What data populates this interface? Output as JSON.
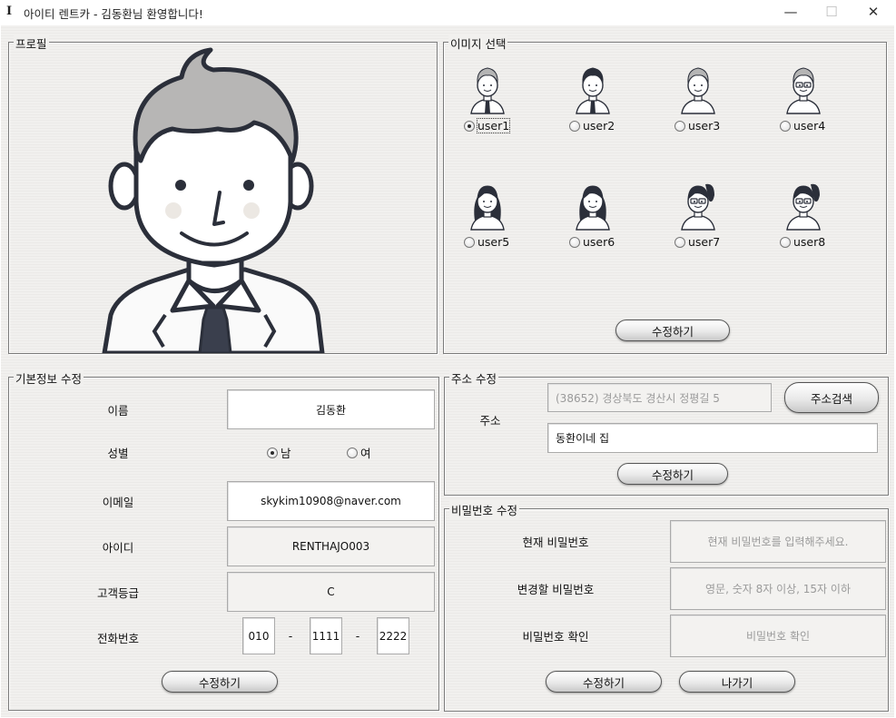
{
  "window": {
    "icon_glyph": "I",
    "title": "아이티 렌트카 - 김동환님 환영합니다!",
    "minimize": "—",
    "maximize": "☐",
    "close": "✕"
  },
  "profile": {
    "legend": "프로필"
  },
  "image_select": {
    "legend": "이미지 선택",
    "options": [
      {
        "label": "user1",
        "selected": true
      },
      {
        "label": "user2",
        "selected": false
      },
      {
        "label": "user3",
        "selected": false
      },
      {
        "label": "user4",
        "selected": false
      },
      {
        "label": "user5",
        "selected": false
      },
      {
        "label": "user6",
        "selected": false
      },
      {
        "label": "user7",
        "selected": false
      },
      {
        "label": "user8",
        "selected": false
      }
    ],
    "submit_label": "수정하기"
  },
  "basic_info": {
    "legend": "기본정보 수정",
    "name_label": "이름",
    "name_value": "김동환",
    "gender_label": "성별",
    "gender_male": "남",
    "gender_female": "여",
    "email_label": "이메일",
    "email_value": "skykim10908@naver.com",
    "id_label": "아이디",
    "id_value": "RENTHAJO003",
    "grade_label": "고객등급",
    "grade_value": "C",
    "phone_label": "전화번호",
    "phone_1": "010",
    "phone_2": "1111",
    "phone_3": "2222",
    "phone_sep": "-",
    "submit_label": "수정하기"
  },
  "address": {
    "legend": "주소 수정",
    "label": "주소",
    "main_value": "(38652) 경상북도 경산시 정평길 5",
    "detail_value": "동환이네 집",
    "search_label": "주소검색",
    "submit_label": "수정하기"
  },
  "password": {
    "legend": "비밀번호 수정",
    "current_label": "현재 비밀번호",
    "current_placeholder": "현재 비밀번호를 입력해주세요.",
    "new_label": "변경할 비밀번호",
    "new_placeholder": "영문, 숫자 8자 이상, 15자 이하",
    "confirm_label": "비밀번호 확인",
    "confirm_placeholder": "비밀번호 확인",
    "submit_label": "수정하기",
    "exit_label": "나가기"
  }
}
